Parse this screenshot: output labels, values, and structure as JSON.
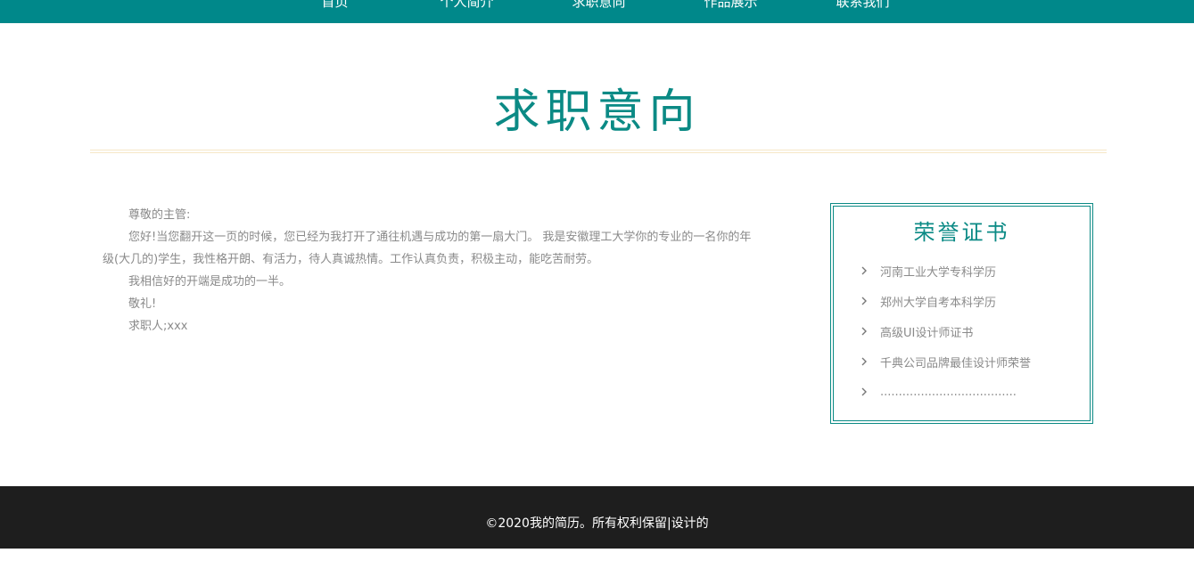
{
  "nav": {
    "items": [
      "首页",
      "个人简介",
      "求职意向",
      "作品展示",
      "联系我们"
    ]
  },
  "section": {
    "title": "求职意向"
  },
  "letter": {
    "greeting": "尊敬的主管:",
    "body": "您好!当您翻开这一页的时候，您已经为我打开了通往机遇与成功的第一扇大门。 我是安徽理工大学你的专业的一名你的年级(大几的)学生，我性格开朗、有活力，待人真诚热情。工作认真负责，积极主动，能吃苦耐劳。",
    "line2": "我相信好的开端是成功的一半。",
    "closing": "敬礼!",
    "signature": "求职人;xxx"
  },
  "honors": {
    "title": "荣誉证书",
    "items": [
      "河南工业大学专科学历",
      "郑州大学自考本科学历",
      "高级UI设计师证书",
      "千典公司品牌最佳设计师荣誉",
      "....................................."
    ],
    "icon": "chevron-right-icon"
  },
  "footer": {
    "text": "©2020我的简历。所有权利保留|设计的"
  },
  "colors": {
    "brand": "#00888a",
    "footer_bg": "#1e1e1e",
    "rule": "#f6e7c7"
  }
}
